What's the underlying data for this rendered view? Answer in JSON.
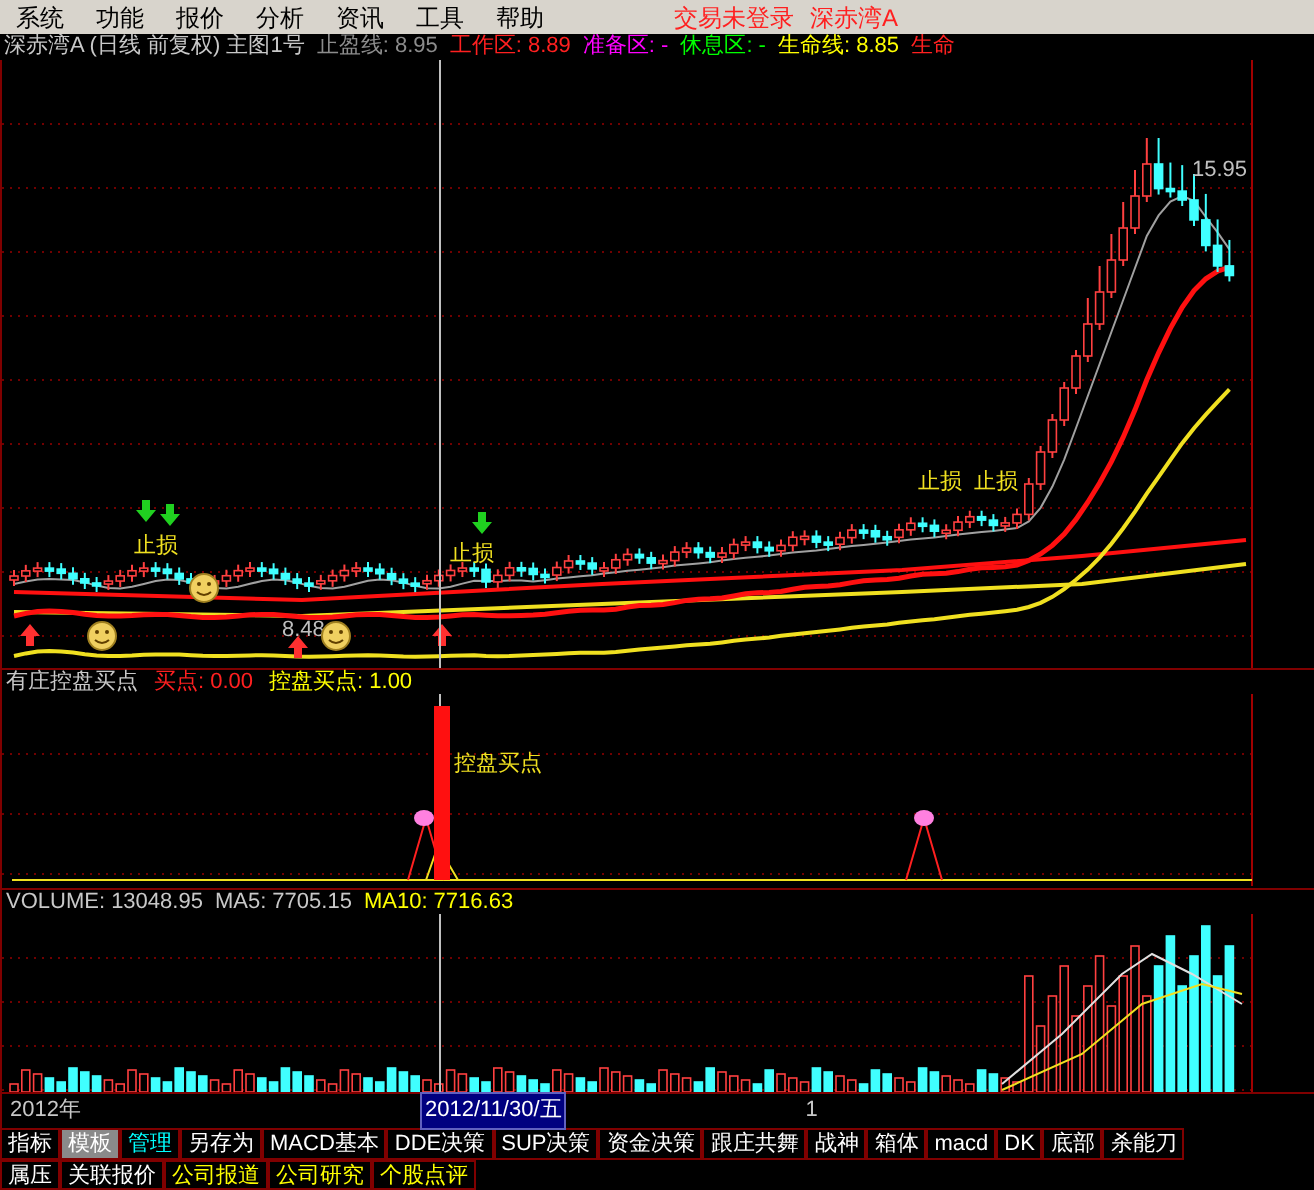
{
  "menu": [
    {
      "label": "系统"
    },
    {
      "label": "功能"
    },
    {
      "label": "报价"
    },
    {
      "label": "分析"
    },
    {
      "label": "资讯"
    },
    {
      "label": "工具"
    },
    {
      "label": "帮助"
    }
  ],
  "login_status": "交易未登录",
  "stock_name": "深赤湾A",
  "info_bar": [
    {
      "text": "深赤湾A (日线 前复权) 主图1号",
      "color": "#c8c8c8"
    },
    {
      "text": "止盈线: 8.95",
      "color": "#8c8c8c"
    },
    {
      "text": "工作区: 8.89",
      "color": "#ff2020"
    },
    {
      "text": "准备区: -",
      "color": "#ff00ff"
    },
    {
      "text": "休息区: -",
      "color": "#00ff00"
    },
    {
      "text": "生命线: 8.85",
      "color": "#ffff00"
    },
    {
      "text": "生命",
      "color": "#ff2020"
    }
  ],
  "main_chart": {
    "high_label": "15.95",
    "low_label": "8.48",
    "stop_labels": [
      "止损",
      "止损",
      "止损",
      "止损"
    ]
  },
  "indicator": {
    "title": "有庄控盘买点",
    "legend": [
      {
        "text": "买点: 0.00",
        "color": "#ff2020"
      },
      {
        "text": "控盘买点: 1.00",
        "color": "#ffff00"
      }
    ],
    "bar_label": "控盘买点"
  },
  "volume": {
    "legend": [
      {
        "text": "VOLUME: 13048.95",
        "color": "#c8c8c8"
      },
      {
        "text": "MA5: 7705.15",
        "color": "#c8c8c8"
      },
      {
        "text": "MA10: 7716.63",
        "color": "#ffff00"
      }
    ]
  },
  "axis": {
    "year": "2012年",
    "cursor_date": "2012/11/30/五",
    "tick": "1"
  },
  "tabs": [
    {
      "label": "指标",
      "selected": false,
      "highlighted": false
    },
    {
      "label": "模板",
      "selected": true,
      "highlighted": false
    },
    {
      "label": "管理",
      "selected": false,
      "highlighted": true
    },
    {
      "label": "另存为",
      "selected": false,
      "highlighted": false
    },
    {
      "label": "MACD基本",
      "selected": false,
      "highlighted": false
    },
    {
      "label": "DDE决策",
      "selected": false,
      "highlighted": false
    },
    {
      "label": "SUP决策",
      "selected": false,
      "highlighted": false
    },
    {
      "label": "资金决策",
      "selected": false,
      "highlighted": false
    },
    {
      "label": "跟庄共舞",
      "selected": false,
      "highlighted": false
    },
    {
      "label": "战神",
      "selected": false,
      "highlighted": false
    },
    {
      "label": "箱体",
      "selected": false,
      "highlighted": false
    },
    {
      "label": "macd",
      "selected": false,
      "highlighted": false
    },
    {
      "label": "DK",
      "selected": false,
      "highlighted": false
    },
    {
      "label": "底部",
      "selected": false,
      "highlighted": false
    },
    {
      "label": "杀能刀",
      "selected": false,
      "highlighted": false
    }
  ],
  "bottom_tabs": [
    {
      "label": "属压",
      "highlighted": false
    },
    {
      "label": "关联报价",
      "highlighted": false
    },
    {
      "label": "公司报道",
      "highlighted": true
    },
    {
      "label": "公司研究",
      "highlighted": true
    },
    {
      "label": "个股点评",
      "highlighted": true
    }
  ]
}
